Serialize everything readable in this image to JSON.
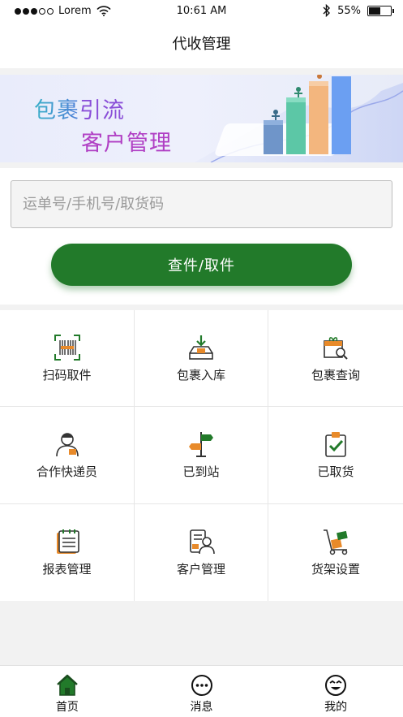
{
  "status_bar": {
    "carrier": "Lorem",
    "time": "10:61 AM",
    "battery": "55%",
    "battery_level": 0.55
  },
  "header": {
    "title": "代收管理"
  },
  "banner": {
    "line1_part1": "包裹",
    "line1_part2": "引流",
    "line2": "客户管理"
  },
  "search": {
    "placeholder": "运单号/手机号/取货码",
    "value": ""
  },
  "query_button": {
    "label": "查件/取件"
  },
  "grid": [
    {
      "label": "扫码取件",
      "icon": "barcode-scan-icon"
    },
    {
      "label": "包裹入库",
      "icon": "package-inbound-icon"
    },
    {
      "label": "包裹查询",
      "icon": "package-search-icon"
    },
    {
      "label": "合作快递员",
      "icon": "courier-icon"
    },
    {
      "label": "已到站",
      "icon": "signpost-icon"
    },
    {
      "label": "已取货",
      "icon": "clipboard-check-icon"
    },
    {
      "label": "报表管理",
      "icon": "report-icon"
    },
    {
      "label": "客户管理",
      "icon": "customer-icon"
    },
    {
      "label": "货架设置",
      "icon": "shelf-cart-icon"
    }
  ],
  "tabs": [
    {
      "label": "首页",
      "icon": "home-icon",
      "active": true
    },
    {
      "label": "消息",
      "icon": "message-icon",
      "active": false
    },
    {
      "label": "我的",
      "icon": "smiley-icon",
      "active": false
    }
  ],
  "colors": {
    "primary": "#227a2a",
    "accent_orange": "#e88a2a"
  }
}
